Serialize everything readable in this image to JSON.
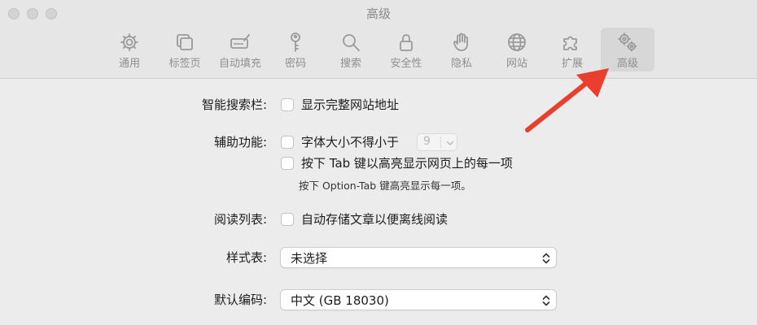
{
  "window": {
    "title": "高级"
  },
  "tabs": [
    {
      "label": "通用",
      "icon": "gear-icon"
    },
    {
      "label": "标签页",
      "icon": "tabs-icon"
    },
    {
      "label": "自动填充",
      "icon": "autofill-icon"
    },
    {
      "label": "密码",
      "icon": "key-icon"
    },
    {
      "label": "搜索",
      "icon": "search-icon"
    },
    {
      "label": "安全性",
      "icon": "lock-icon"
    },
    {
      "label": "隐私",
      "icon": "hand-icon"
    },
    {
      "label": "网站",
      "icon": "globe-icon"
    },
    {
      "label": "扩展",
      "icon": "puzzle-icon"
    },
    {
      "label": "高级",
      "icon": "gears-icon",
      "active": true
    }
  ],
  "settings": {
    "smart_search": {
      "label": "智能搜索栏:",
      "checkbox": "显示完整网站地址",
      "checked": false
    },
    "accessibility": {
      "label": "辅助功能:",
      "font_checkbox": "字体大小不得小于",
      "font_checked": false,
      "font_size_value": "9",
      "tab_checkbox": "按下 Tab 键以高亮显示网页上的每一项",
      "tab_checked": false,
      "tab_note": "按下 Option-Tab 键高亮显示每一项。"
    },
    "reading_list": {
      "label": "阅读列表:",
      "checkbox": "自动存储文章以便离线阅读",
      "checked": false
    },
    "style_sheet": {
      "label": "样式表:",
      "value": "未选择"
    },
    "default_encoding": {
      "label": "默认编码:",
      "value": "中文 (GB 18030)"
    }
  },
  "colors": {
    "annotation_arrow": "#e8402d",
    "active_tab_bg": "#d7d7d7"
  }
}
